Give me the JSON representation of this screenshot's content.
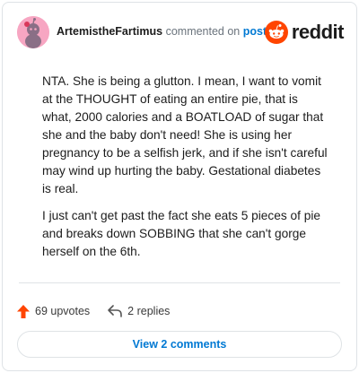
{
  "header": {
    "username": "ArtemistheFartimus",
    "action": "commented on",
    "post_link": "post",
    "logo_text": "reddit",
    "avatar_icon": "snoo-avatar-icon",
    "logo_icon": "reddit-snoo-icon",
    "brand_color": "#ff4500"
  },
  "comment": {
    "paragraphs": [
      "NTA. She is being a glutton. I mean, I want to vomit at the THOUGHT of eating an entire pie, that is what, 2000 calories and a BOATLOAD of sugar that she and the baby don't need! She is using her pregnancy to be a selfish jerk, and if she isn't careful may wind up hurting the baby. Gestational diabetes is real.",
      "I just can't get past the fact she eats 5 pieces of pie and breaks down SOBBING that she can't gorge herself on the 6th."
    ]
  },
  "actions": {
    "upvotes": "69 upvotes",
    "replies": "2 replies",
    "upvote_icon": "upvote-arrow-icon",
    "reply_icon": "reply-arrow-icon"
  },
  "footer": {
    "view_comments": "View 2 comments"
  }
}
